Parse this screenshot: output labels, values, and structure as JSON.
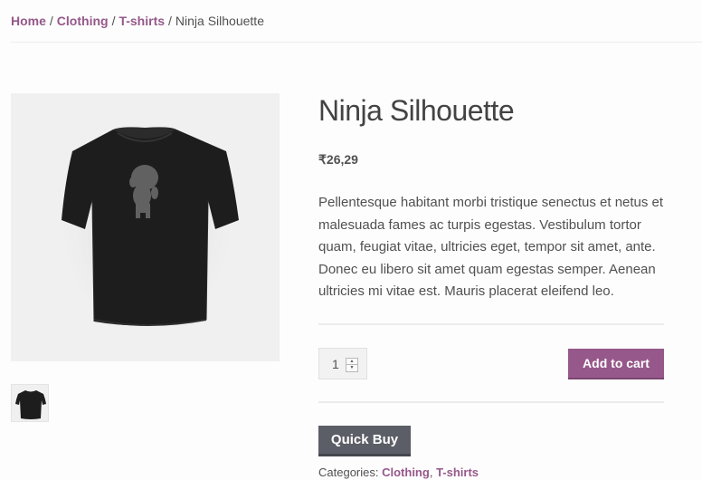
{
  "breadcrumb": {
    "items": [
      "Home",
      "Clothing",
      "T-shirts"
    ],
    "separator": "/",
    "current": "Ninja Silhouette"
  },
  "product": {
    "title": "Ninja Silhouette",
    "price": "₹26,29",
    "description": "Pellentesque habitant morbi tristique senectus et netus et malesuada fames ac turpis egestas. Vestibulum tortor quam, feugiat vitae, ultricies eget, tempor sit amet, ante. Donec eu libero sit amet quam egestas semper. Aenean ultricies mi vitae est. Mauris placerat eleifend leo.",
    "image_icon": "black-tshirt-ninja-image",
    "thumbnail_icon": "black-tshirt-thumbnail"
  },
  "cart_form": {
    "quantity": "1",
    "add_to_cart_label": "Add to cart",
    "quick_buy_label": "Quick Buy"
  },
  "meta": {
    "categories_label": "Categories:",
    "categories": [
      "Clothing",
      "T-shirts"
    ],
    "categories_separator": ","
  },
  "colors": {
    "accent": "#96588a",
    "button_dark": "#5b5e66",
    "text": "#515151",
    "title": "#434343"
  }
}
